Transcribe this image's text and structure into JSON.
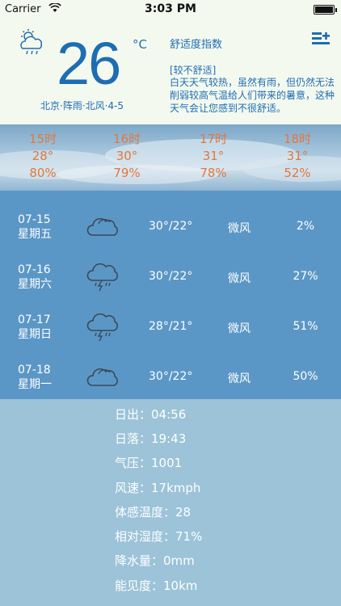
{
  "status_bar": {
    "carrier": "Carrier",
    "time": "3:03 PM"
  },
  "current": {
    "temperature": "26",
    "unit": "°C",
    "summary": "北京·阵雨·北风·4-5",
    "icon": "cloud-sun-rain-icon"
  },
  "comfort": {
    "title": "舒适度指数",
    "level": "[较不舒适]",
    "description": "白天天气较热，虽然有雨，但仍然无法削弱较高气温给人们带来的暑意，这种天气会让您感到不很舒适。"
  },
  "hourly": [
    {
      "time": "15时",
      "temp": "28°",
      "humidity": "80%"
    },
    {
      "time": "16时",
      "temp": "30°",
      "humidity": "79%"
    },
    {
      "time": "17时",
      "temp": "31°",
      "humidity": "78%"
    },
    {
      "time": "18时",
      "temp": "31°",
      "humidity": "52%"
    }
  ],
  "daily": [
    {
      "date": "07-15",
      "weekday": "星期五",
      "icon": "cloudy-icon",
      "range": "30°/22°",
      "wind": "微风",
      "pop": "2%"
    },
    {
      "date": "07-16",
      "weekday": "星期六",
      "icon": "thunderstorm-icon",
      "range": "30°/22°",
      "wind": "微风",
      "pop": "27%"
    },
    {
      "date": "07-17",
      "weekday": "星期日",
      "icon": "thunderstorm-icon",
      "range": "28°/21°",
      "wind": "微风",
      "pop": "51%"
    },
    {
      "date": "07-18",
      "weekday": "星期一",
      "icon": "cloudy-icon",
      "range": "30°/22°",
      "wind": "微风",
      "pop": "50%"
    }
  ],
  "details": [
    {
      "label": "日出：",
      "value": "04:56"
    },
    {
      "label": "日落：",
      "value": "19:43"
    },
    {
      "label": "气压：",
      "value": "1001"
    },
    {
      "label": "风速：",
      "value": "17kmph"
    },
    {
      "label": "体感温度：",
      "value": "28"
    },
    {
      "label": "相对湿度：",
      "value": "71%"
    },
    {
      "label": "降水量：",
      "value": "0mm"
    },
    {
      "label": "能见度：",
      "value": "10km"
    }
  ],
  "colors": {
    "primary_blue": "#1d6db3",
    "hourly_orange": "#e2773e",
    "daily_bg": "#5b97c6",
    "details_bg": "#9cc3d8",
    "header_bg": "#f4f9ef"
  }
}
